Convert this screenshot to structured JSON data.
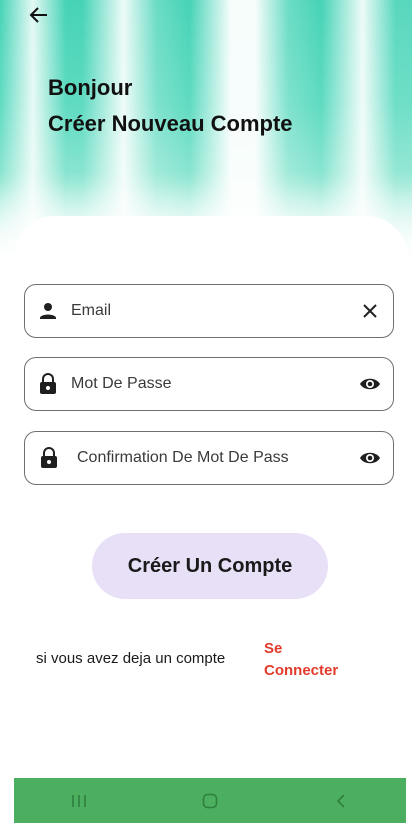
{
  "header": {
    "greeting": "Bonjour",
    "title": "Créer Nouveau Compte"
  },
  "form": {
    "email": {
      "placeholder": "Email",
      "value": ""
    },
    "password": {
      "placeholder": "Mot De Passe",
      "value": ""
    },
    "confirm_password": {
      "placeholder": "Confirmation De Mot De Pass",
      "value": ""
    },
    "submit_label": "Créer Un Compte"
  },
  "login_prompt": {
    "text": "si vous avez deja un compte",
    "link_line1": "Se",
    "link_line2": "Connecter"
  },
  "colors": {
    "accent_teal": "#46d3b6",
    "button_bg": "#e8e0f7",
    "link_red": "#e23b2c",
    "navbar_green": "#4caf5f"
  },
  "icons": {
    "back": "arrow-left-icon",
    "email_lead": "person-icon",
    "email_trail": "close-icon",
    "password_lead": "lock-icon",
    "password_trail": "eye-icon",
    "nav_recents": "recents-icon",
    "nav_home": "home-icon",
    "nav_back": "chevron-left-icon"
  }
}
